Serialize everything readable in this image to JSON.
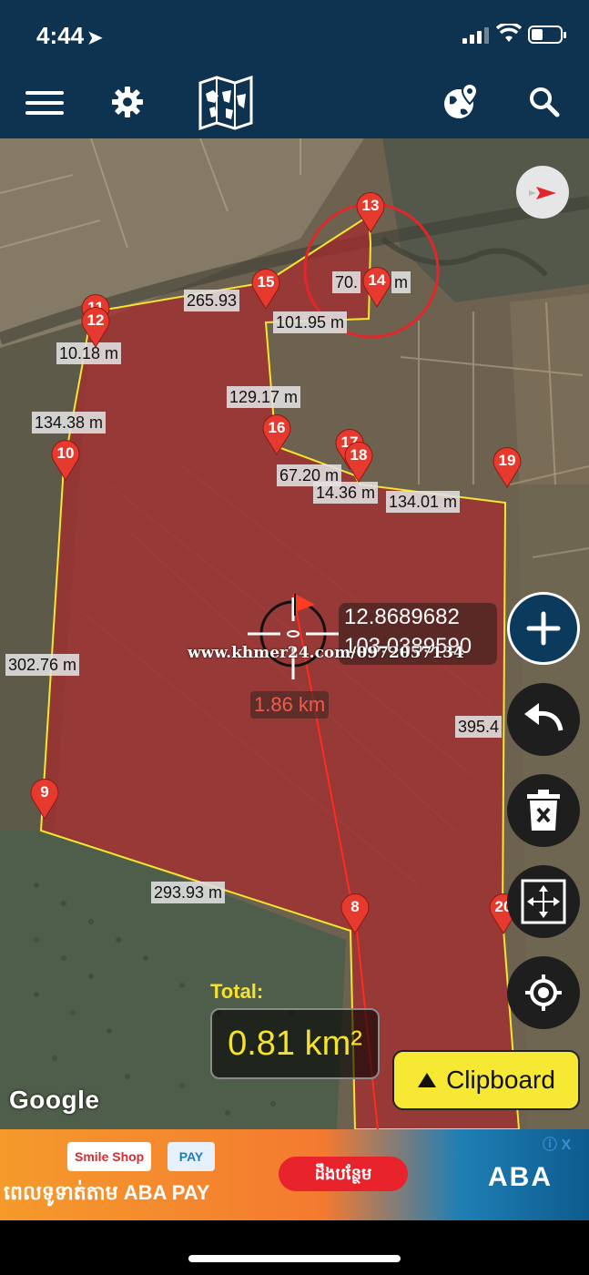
{
  "status_bar": {
    "time": "4:44",
    "location_arrow": "location-arrow-icon"
  },
  "toolbar": {
    "icons": [
      "menu-icon",
      "gear-icon",
      "folded-map-icon",
      "globe-location-icon",
      "search-icon"
    ]
  },
  "map": {
    "measurements": [
      "265.93",
      "70.",
      "m",
      "101.95 m",
      "10.18 m",
      "129.17 m",
      "134.38 m",
      "67.20 m",
      "14.36 m",
      "134.01 m",
      "302.76 m",
      "395.4",
      "293.93 m"
    ],
    "pins": [
      "13",
      "14",
      "15",
      "11",
      "12",
      "16",
      "17",
      "18",
      "19",
      "10",
      "9",
      "8",
      "20"
    ],
    "center": {
      "latitude": "12.8689682",
      "longitude": "103.0389590",
      "distance": "1.86 km"
    },
    "watermark": "www.khmer24.com/0972057134",
    "google": "Google",
    "colors": {
      "area_fill": "#a8292d",
      "perimeter": "#f3e62e",
      "pin": "#e63a2e",
      "line": "#ff2d1f"
    }
  },
  "controls": {
    "add_icon": "plus-icon",
    "undo_icon": "undo-icon",
    "delete_icon": "trash-icon",
    "fit_icon": "fit-bounds-icon",
    "locate_icon": "crosshair-locate-icon",
    "compass_icon": "compass-icon"
  },
  "total": {
    "label": "Total:",
    "value": "0.81 km²"
  },
  "clipboard": {
    "label": "Clipboard"
  },
  "ad": {
    "chip_shop": "Smile Shop",
    "chip_pay": "PAY",
    "title": "ពេលទូទាត់តាម ABA PAY",
    "cta": "ដឹងបន្ថែម",
    "brand": "ABA",
    "info": "ⓘ X"
  }
}
